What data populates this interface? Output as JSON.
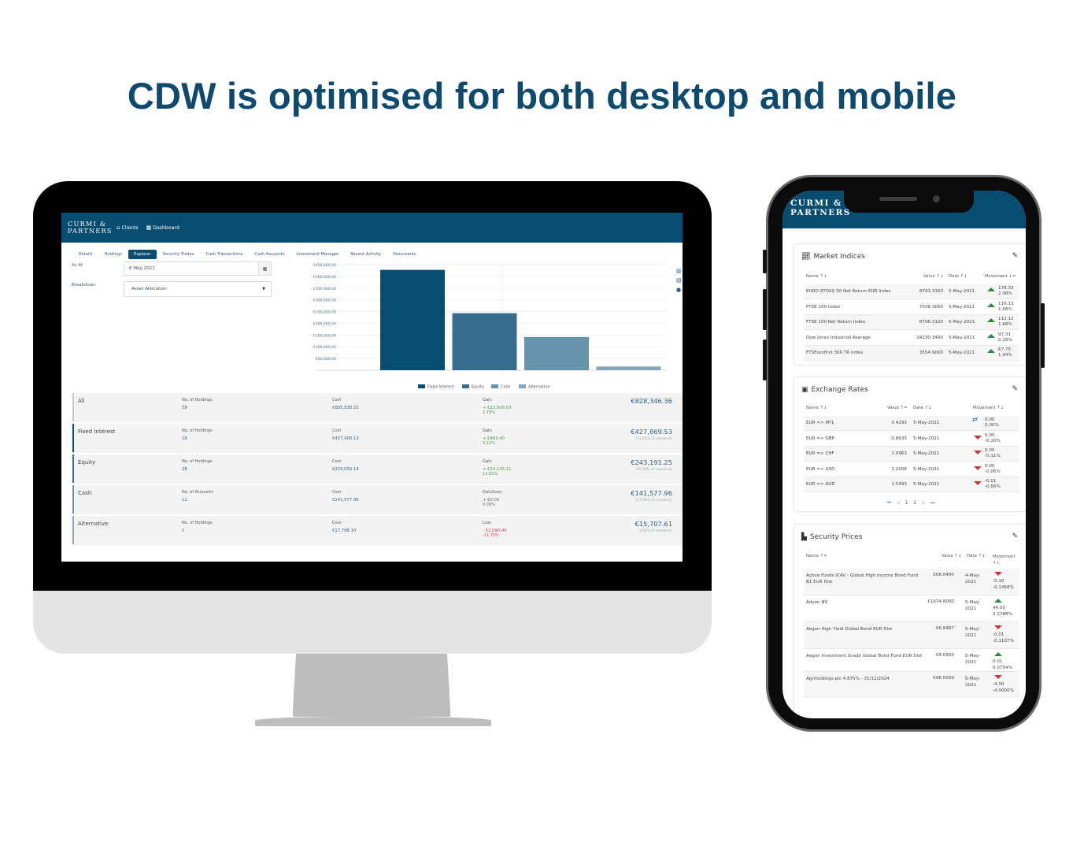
{
  "headline": "CDW is optimised for both desktop and mobile",
  "colors": {
    "brand": "#074d72",
    "headline": "#0d4a6e",
    "gain": "#4b9a4a",
    "loss": "#c0474a",
    "up_arrow": "#2e8a3a",
    "down_arrow": "#c9353b"
  },
  "desktop": {
    "logo_line1": "CURMI &",
    "logo_line2": "PARTNERS",
    "nav": [
      {
        "icon": "home-icon",
        "label": "Clients"
      },
      {
        "icon": "grid-icon",
        "label": "Dashboard"
      }
    ],
    "tabs": [
      {
        "label": "Details",
        "active": false
      },
      {
        "label": "Holdings",
        "active": false
      },
      {
        "label": "Explorer",
        "active": true
      },
      {
        "label": "Security Trades",
        "active": false
      },
      {
        "label": "Cash Transactions",
        "active": false
      },
      {
        "label": "Cash Accounts",
        "active": false
      },
      {
        "label": "Investment Manager",
        "active": false
      },
      {
        "label": "Recent Activity",
        "active": false
      },
      {
        "label": "Documents",
        "active": false
      }
    ],
    "filters": {
      "as_at_label": "As At",
      "as_at_value": "6 May 2021",
      "breakdown_label": "Breakdown",
      "breakdown_value": "Asset Allocation"
    },
    "categories": [
      {
        "name": "All",
        "count_label": "No. of Holdings",
        "count": "58",
        "cost_label": "Cost",
        "cost": "€805,838.33",
        "gain_label": "Gain",
        "gain": "+ €22,508.03",
        "gain_pct": "2.79%",
        "trend": "gain",
        "value": "€828,346.36",
        "valuation_pct": ""
      },
      {
        "name": "Fixed Interest",
        "count_label": "No. of Holdings",
        "count": "18",
        "cost_label": "Cost",
        "cost": "€427,406.13",
        "gain_label": "Gain",
        "gain": "+ €463.40",
        "gain_pct": "0.11%",
        "trend": "gain",
        "value": "€427,869.53",
        "valuation_pct": "(51.65% of valuation)"
      },
      {
        "name": "Equity",
        "count_label": "No. of Holdings",
        "count": "28",
        "cost_label": "Cost",
        "cost": "€219,056.14",
        "gain_label": "Gain",
        "gain": "+ €24,135.11",
        "gain_pct": "11.02%",
        "trend": "gain",
        "value": "€243,191.25",
        "valuation_pct": "(29.36% of valuation)"
      },
      {
        "name": "Cash",
        "count_label": "No. of Accounts",
        "count": "11",
        "cost_label": "Cost",
        "cost": "€141,577.96",
        "gain_label": "Gain/Loss",
        "gain": "+ €0.00",
        "gain_pct": "0.00%",
        "trend": "neutral",
        "value": "€141,577.96",
        "valuation_pct": "(17.09% of valuation)"
      },
      {
        "name": "Alternative",
        "count_label": "No. of Holdings",
        "count": "1",
        "cost_label": "Cost",
        "cost": "€17,798.10",
        "gain_label": "Loss",
        "gain": "- €2,090.49",
        "gain_pct": "-11.75%",
        "trend": "loss",
        "value": "€15,707.61",
        "valuation_pct": "(1.90% of valuation)"
      }
    ]
  },
  "chart_data": {
    "type": "bar",
    "title": "",
    "xlabel": "",
    "ylabel": "",
    "categories": [
      "Fixed Interest",
      "Equity",
      "Cash",
      "Alternative"
    ],
    "values": [
      427869.53,
      243191.25,
      141577.96,
      15707.61
    ],
    "colors": [
      "#074d72",
      "#376d8c",
      "#6893ab",
      "#86a6ba"
    ],
    "ylim": [
      0,
      450000
    ],
    "yticks": [
      50000,
      100000,
      150000,
      200000,
      250000,
      300000,
      350000,
      400000,
      450000
    ],
    "ytick_labels": [
      "€50,000.00",
      "€100,000.00",
      "€150,000.00",
      "€200,000.00",
      "€250,000.00",
      "€300,000.00",
      "€350,000.00",
      "€400,000.00",
      "€450,000.00"
    ],
    "grid": true,
    "legend": [
      "Fixed Interest",
      "Equity",
      "Cash",
      "Alternative"
    ],
    "legend_position": "bottom"
  },
  "mobile": {
    "logo_line1": "CURMI &",
    "logo_line2": "PARTNERS",
    "market_indices": {
      "title": "Market Indices",
      "headers": [
        "Name ↑↓",
        "Value ↑↓",
        "Date ↑↓",
        "Movement ↓="
      ],
      "rows": [
        {
          "name": "EURO STOXX 50 Net Return EUR Index",
          "value": "8743.3300",
          "date": "5-May-2021",
          "dir": "up",
          "move": "178.33",
          "pct": "2.08%"
        },
        {
          "name": "FTSE 100 Index",
          "value": "7039.3000",
          "date": "5-May-2021",
          "dir": "up",
          "move": "116.13",
          "pct": "1.68%"
        },
        {
          "name": "FTSE 100 Net Return Index",
          "value": "6796.3100",
          "date": "5-May-2021",
          "dir": "up",
          "move": "112.12",
          "pct": "1.68%"
        },
        {
          "name": "Dow Jones Industrial Average",
          "value": "34230.3400",
          "date": "5-May-2021",
          "dir": "up",
          "move": "97.31",
          "pct": "0.29%"
        },
        {
          "name": "FTSEurofirst 300 TR Index",
          "value": "3554.9000",
          "date": "5-May-2021",
          "dir": "up",
          "move": "67.75",
          "pct": "1.94%"
        }
      ]
    },
    "exchange_rates": {
      "title": "Exchange Rates",
      "headers": [
        "Name ↑↓",
        "Value ↑=",
        "Date ↑↓",
        "Movement ↑↓"
      ],
      "rows": [
        {
          "name": "EUR => MTL",
          "value": "0.4293",
          "date": "5-May-2021",
          "dir": "flat",
          "move": "0.00",
          "pct": "0.00%"
        },
        {
          "name": "EUR => GBP",
          "value": "0.8633",
          "date": "5-May-2021",
          "dir": "down",
          "move": "0.00",
          "pct": "-0.20%"
        },
        {
          "name": "EUR => CHF",
          "value": "1.0963",
          "date": "5-May-2021",
          "dir": "down",
          "move": "0.00",
          "pct": "-0.11%"
        },
        {
          "name": "EUR => USD",
          "value": "1.2006",
          "date": "5-May-2021",
          "dir": "down",
          "move": "0.00",
          "pct": "-0.06%"
        },
        {
          "name": "EUR => AUD",
          "value": "1.5493",
          "date": "5-May-2021",
          "dir": "down",
          "move": "-0.01",
          "pct": "-0.56%"
        }
      ],
      "pager": {
        "first": "⏮",
        "prev": "◁",
        "pages": [
          "1",
          "2"
        ],
        "next": "▷",
        "last": "⏭"
      }
    },
    "security_prices": {
      "title": "Security Prices",
      "headers": [
        "Name ↑=",
        "Value ↑↓",
        "Date ↑↓",
        "Movement ↑↓"
      ],
      "rows": [
        {
          "name": "Active Funds ICAV - Global High Income Bond Fund B1 EUR Dist",
          "value": "€68.0400",
          "date": "4-May-2021",
          "dir": "down",
          "move": "-0.10",
          "pct": "-0.1468%"
        },
        {
          "name": "Adyen NV",
          "value": "€1974.8000",
          "date": "5-May-2021",
          "dir": "up",
          "move": "44.00",
          "pct": "2.2788%"
        },
        {
          "name": "Aegon High Yield Global Bond EUR Dist",
          "value": "€6.8487",
          "date": "5-May-2021",
          "dir": "down",
          "move": "-0.01",
          "pct": "-0.1167%"
        },
        {
          "name": "Aegon Investment Grade Global Bond Fund EUR Dist",
          "value": "€8.0950",
          "date": "5-May-2021",
          "dir": "up",
          "move": "0.01",
          "pct": "0.0754%"
        },
        {
          "name": "Agriholdings plc 4.875% - 31/12/2024",
          "value": "€96.0000",
          "date": "5-May-2021",
          "dir": "down",
          "move": "-4.00",
          "pct": "-4.0000%"
        }
      ]
    }
  }
}
